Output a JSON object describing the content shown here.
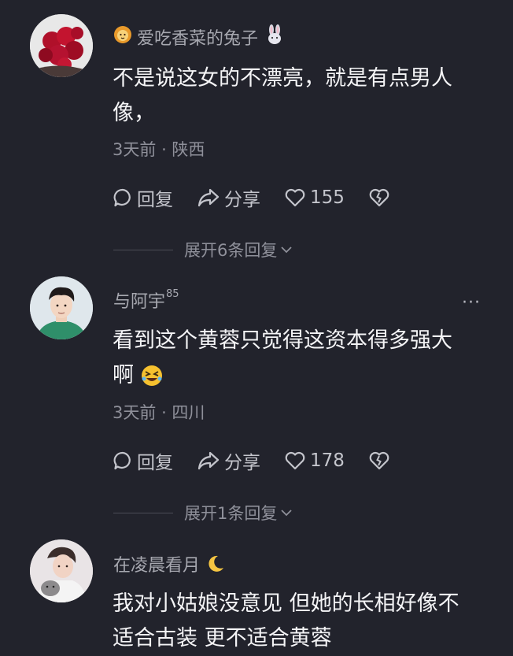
{
  "comments": [
    {
      "username": "爱吃香菜的兔子",
      "username_prefix_icon": "lion-badge-icon",
      "username_suffix_icon": "rabbit-icon",
      "text_line1": "不是说这女的不漂亮，就是有点男人",
      "text_line2": "像，",
      "time": "3天前",
      "location": "陕西",
      "reply_label": "回复",
      "share_label": "分享",
      "likes": "155",
      "expand_label": "展开6条回复"
    },
    {
      "username": "与阿宇",
      "username_level": "85",
      "text_line1": "看到这个黄蓉只觉得这资本得多强大",
      "text_line2": "啊",
      "text_emoji": "rofl-emoji-icon",
      "time": "3天前",
      "location": "四川",
      "reply_label": "回复",
      "share_label": "分享",
      "likes": "178",
      "expand_label": "展开1条回复",
      "more_label": "···"
    },
    {
      "username": "在凌晨看月",
      "username_suffix_icon": "crescent-moon-icon",
      "text_line1": "我对小姑娘没意见 但她的长相好像不",
      "text_line2": "适合古装 更不适合黄蓉"
    }
  ],
  "colors": {
    "background": "#22232c",
    "text": "#f4f4f6",
    "muted": "#8f909a",
    "username": "#a7a8b0"
  }
}
